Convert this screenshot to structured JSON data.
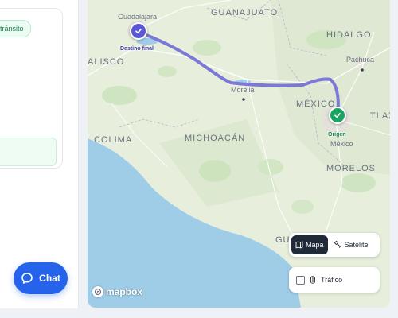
{
  "sidebar": {
    "badge_text": "tránsito",
    "chat_label": "Chat"
  },
  "map": {
    "region_labels": [
      "GUANAJUATO",
      "HIDALGO",
      "ALISCO",
      "MÉXICO",
      "TLAX",
      "COLIMA",
      "MICHOACÁN",
      "MORELOS",
      "GU"
    ],
    "city_labels": [
      "Guadalajara",
      "Pachuca",
      "Morelia",
      "México"
    ],
    "destination_label": "Destino final",
    "origin_label": "Origen",
    "layer_buttons": {
      "map": "Mapa",
      "satellite": "Satélite"
    },
    "traffic_label": "Tráfico",
    "attribution": "mapbox",
    "route_color": "#7b78d8",
    "destination_color": "#5b57d6",
    "origin_color": "#19a463",
    "water_color": "#9fcde8"
  }
}
